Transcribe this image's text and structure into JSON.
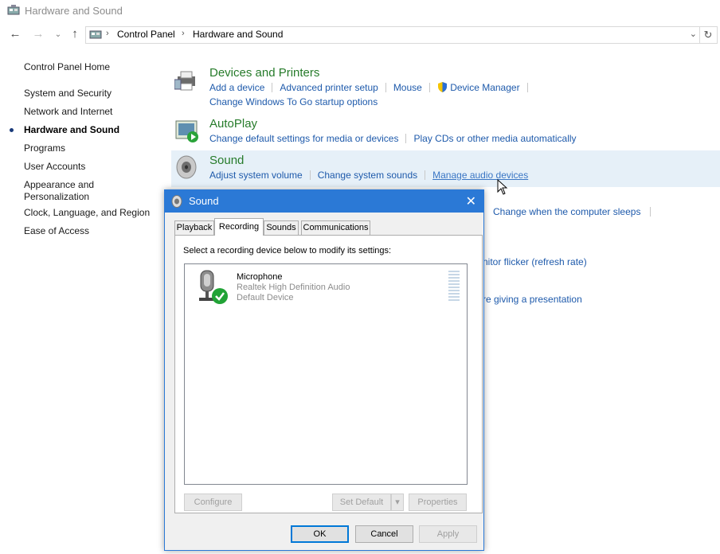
{
  "window": {
    "title": "Hardware and Sound"
  },
  "address": {
    "crumbs": [
      "Control Panel",
      "Hardware and Sound"
    ]
  },
  "leftnav": {
    "items": [
      {
        "label": "Control Panel Home"
      },
      {
        "label": "System and Security"
      },
      {
        "label": "Network and Internet"
      },
      {
        "label": "Hardware and Sound",
        "active": true
      },
      {
        "label": "Programs"
      },
      {
        "label": "User Accounts"
      },
      {
        "label": "Appearance and Personalization"
      },
      {
        "label": "Clock, Language, and Region"
      },
      {
        "label": "Ease of Access"
      }
    ],
    "appearance_line1": "Appearance and",
    "appearance_line2": "Personalization"
  },
  "categories": {
    "devices": {
      "title": "Devices and Printers",
      "links": [
        "Add a device",
        "Advanced printer setup",
        "Mouse",
        "Device Manager",
        "Change Windows To Go startup options"
      ]
    },
    "autoplay": {
      "title": "AutoPlay",
      "links": [
        "Change default settings for media or devices",
        "Play CDs or other media automatically"
      ]
    },
    "sound": {
      "title": "Sound",
      "links": [
        "Adjust system volume",
        "Change system sounds",
        "Manage audio devices"
      ]
    }
  },
  "background_links": [
    "Change when the computer sleeps",
    "nitor flicker (refresh rate)",
    "re giving a presentation"
  ],
  "dialog": {
    "title": "Sound",
    "tabs": [
      "Playback",
      "Recording",
      "Sounds",
      "Communications"
    ],
    "selected_tab": "Recording",
    "hint": "Select a recording device below to modify its settings:",
    "device": {
      "name": "Microphone",
      "driver": "Realtek High Definition Audio",
      "status": "Default Device"
    },
    "buttons": {
      "configure": "Configure",
      "set_default": "Set Default",
      "properties": "Properties",
      "ok": "OK",
      "cancel": "Cancel",
      "apply": "Apply"
    }
  },
  "colors": {
    "accent": "#2b79d6",
    "link": "#1e5aab",
    "category_title": "#267b2a"
  }
}
